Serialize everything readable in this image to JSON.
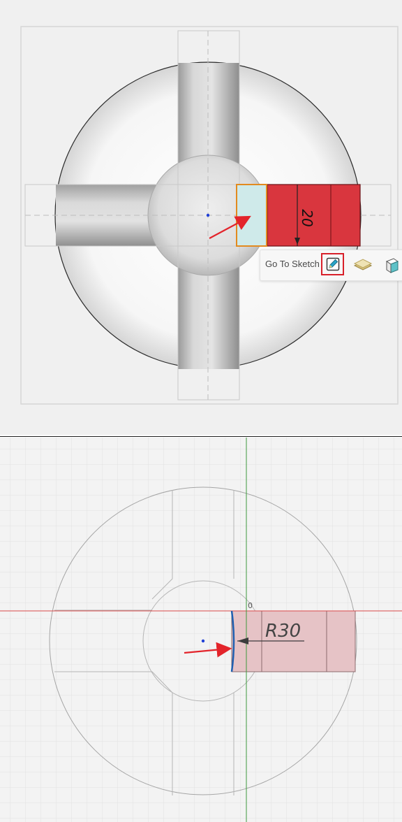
{
  "top_view": {
    "dimension_label": "20",
    "toolbar": {
      "go_to_sketch_label": "Go To Sketch",
      "icons": [
        "edit-sketch-icon",
        "sketch-plane-icon",
        "extrude-icon"
      ]
    },
    "colors": {
      "selected_face": "#d9363e",
      "highlight_face": "#cfeaea",
      "highlight_outline": "#e28a1f",
      "annotation_arrow": "#e3242b",
      "callout_box": "#d8202a"
    }
  },
  "bottom_view": {
    "radius_dimension": "R30",
    "origin_label": "0",
    "colors": {
      "x_axis": "#d94a4a",
      "y_axis": "#3e9a3e",
      "profile_fill": "#e6c3c6",
      "selected_arc": "#1f5fb0",
      "annotation_arrow": "#e3242b"
    }
  }
}
